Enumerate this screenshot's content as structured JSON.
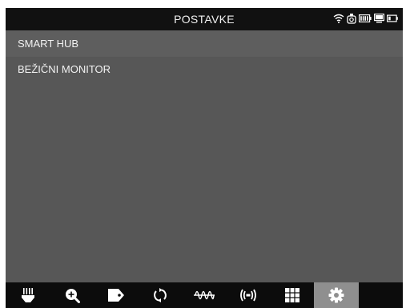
{
  "header": {
    "title": "POSTAVKE",
    "status_icons": [
      "wifi-icon",
      "camera-icon",
      "battery-icon",
      "monitor-icon",
      "small-battery-icon"
    ]
  },
  "menu": {
    "items": [
      {
        "label": "SMART HUB"
      },
      {
        "label": "BEŽIČNI MONITOR"
      }
    ]
  },
  "toolbar": {
    "buttons": [
      {
        "icon": "brush-icon",
        "active": false
      },
      {
        "icon": "zoom-in-icon",
        "active": false
      },
      {
        "icon": "tag-icon",
        "active": false
      },
      {
        "icon": "rotate-icon",
        "active": false
      },
      {
        "icon": "waveform-icon",
        "active": false
      },
      {
        "icon": "wireless-icon",
        "active": false
      },
      {
        "icon": "grid-icon",
        "active": false
      },
      {
        "icon": "settings-icon",
        "active": true
      }
    ]
  },
  "colors": {
    "background": "#575757",
    "titlebar": "#111111",
    "toolbar": "#0c0c0c",
    "active_tab": "#8f8f8f"
  }
}
